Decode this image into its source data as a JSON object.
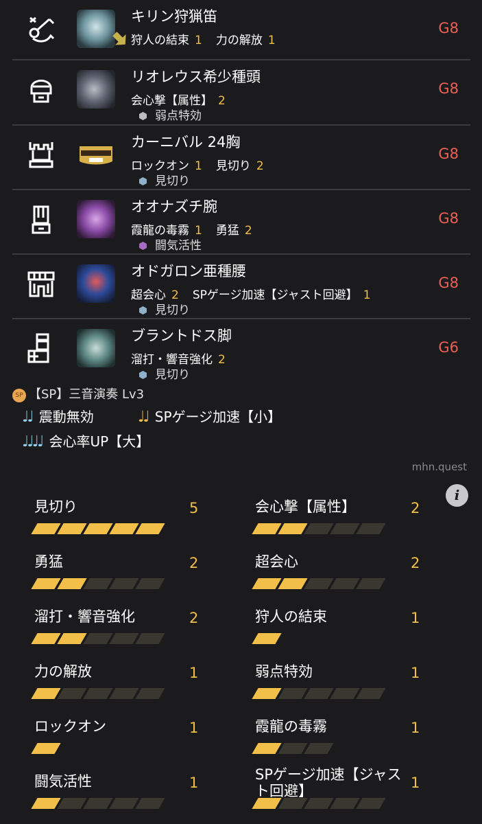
{
  "equipment": [
    {
      "slot_icon": "weapon-horn-icon",
      "name": "キリン狩猟笛",
      "skills": [
        {
          "name": "狩人の結束",
          "level": "1"
        },
        {
          "name": "力の解放",
          "level": "1"
        }
      ],
      "decoration": null,
      "grade": "G8"
    },
    {
      "slot_icon": "helmet-icon",
      "name": "リオレウス希少種頭",
      "skills": [
        {
          "name": "会心撃【属性】",
          "level": "2"
        }
      ],
      "decoration": {
        "name": "弱点特効",
        "color": "#bdbdbd"
      },
      "grade": "G8"
    },
    {
      "slot_icon": "chest-armor-icon",
      "name": "カーニバル 24胸",
      "skills": [
        {
          "name": "ロックオン",
          "level": "1"
        },
        {
          "name": "見切り",
          "level": "2"
        }
      ],
      "decoration": {
        "name": "見切り",
        "color": "#8fb0c7"
      },
      "grade": "G8"
    },
    {
      "slot_icon": "arm-armor-icon",
      "name": "オオナズチ腕",
      "skills": [
        {
          "name": "霞龍の毒霧",
          "level": "1"
        },
        {
          "name": "勇猛",
          "level": "2"
        }
      ],
      "decoration": {
        "name": "闘気活性",
        "color": "#a86bc4"
      },
      "grade": "G8"
    },
    {
      "slot_icon": "waist-armor-icon",
      "name": "オドガロン亜種腰",
      "skills": [
        {
          "name": "超会心",
          "level": "2"
        },
        {
          "name": "SPゲージ加速【ジャスト回避】",
          "level": "1"
        }
      ],
      "decoration": {
        "name": "見切り",
        "color": "#8fb0c7"
      },
      "grade": "G8"
    },
    {
      "slot_icon": "leg-armor-icon",
      "name": "ブラントドス脚",
      "skills": [
        {
          "name": "溜打・響音強化",
          "level": "2"
        }
      ],
      "decoration": {
        "name": "見切り",
        "color": "#8fb0c7"
      },
      "grade": "G6"
    }
  ],
  "sp_skill": {
    "badge": "SP",
    "title": "【SP】三音演奏 Lv3",
    "songs": [
      {
        "notes": "♩♩",
        "label": "震動無効",
        "color": "#8fd0ea"
      },
      {
        "notes": "♩♩",
        "label": "SPゲージ加速【小】",
        "color": "#f2bf48"
      },
      {
        "notes": "♩♩♩♩",
        "label": "会心率UP【大】",
        "color": "#8fd0ea"
      }
    ]
  },
  "site_label": "mhn.quest",
  "info_label": "i",
  "skill_summary": [
    {
      "name": "見切り",
      "level": "5",
      "level_value": 5,
      "max": 5
    },
    {
      "name": "会心撃【属性】",
      "level": "2",
      "level_value": 2,
      "max": 5
    },
    {
      "name": "勇猛",
      "level": "2",
      "level_value": 2,
      "max": 5
    },
    {
      "name": "超会心",
      "level": "2",
      "level_value": 2,
      "max": 5
    },
    {
      "name": "溜打・響音強化",
      "level": "2",
      "level_value": 2,
      "max": 5
    },
    {
      "name": "狩人の結束",
      "level": "1",
      "level_value": 1,
      "max": 1
    },
    {
      "name": "力の解放",
      "level": "1",
      "level_value": 1,
      "max": 5
    },
    {
      "name": "弱点特効",
      "level": "1",
      "level_value": 1,
      "max": 5
    },
    {
      "name": "ロックオン",
      "level": "1",
      "level_value": 1,
      "max": 1
    },
    {
      "name": "霞龍の毒霧",
      "level": "1",
      "level_value": 1,
      "max": 3
    },
    {
      "name": "闘気活性",
      "level": "1",
      "level_value": 1,
      "max": 5
    },
    {
      "name": "SPゲージ加速【ジャスト回避】",
      "level": "1",
      "level_value": 1,
      "max": 5
    }
  ],
  "colors": {
    "accent": "#f2bf48",
    "grade": "#ee5f55",
    "background": "#1b1b1d"
  }
}
